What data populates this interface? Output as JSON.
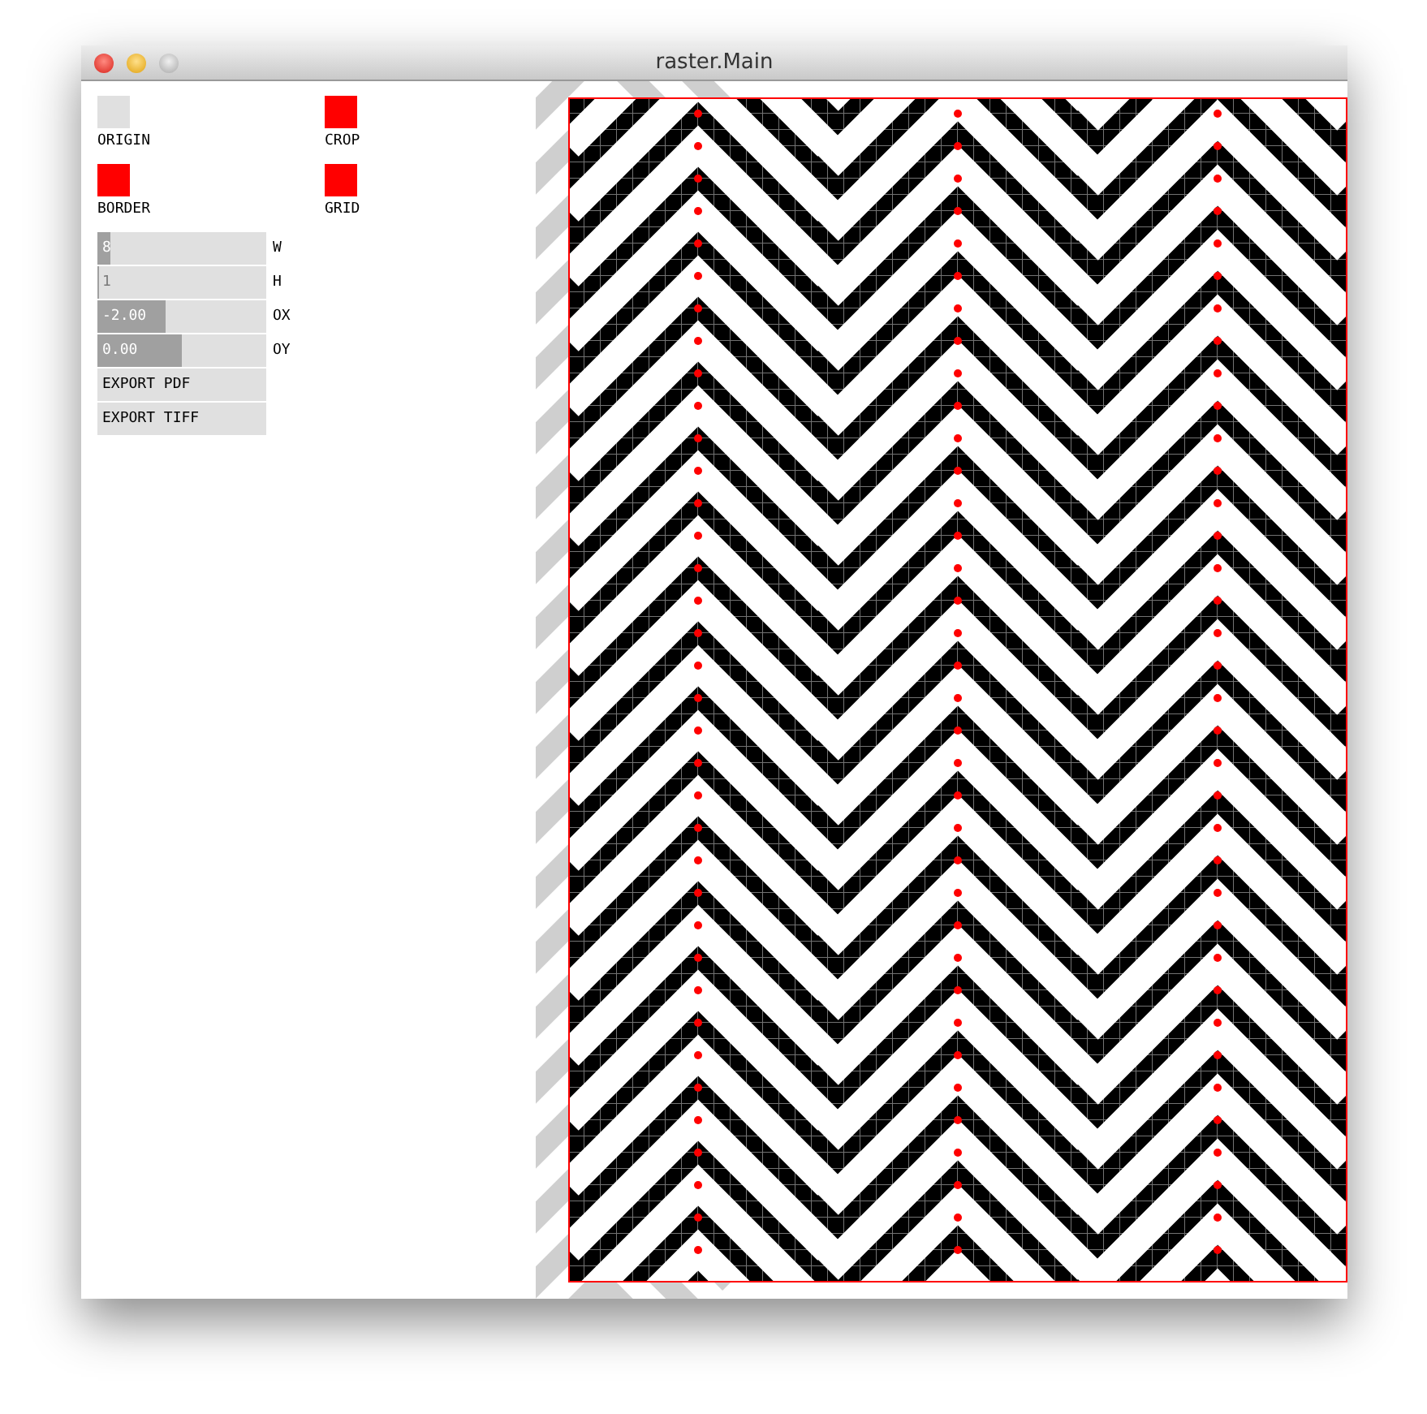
{
  "window": {
    "title": "raster.Main"
  },
  "toggles": [
    {
      "label": "ORIGIN",
      "on": false
    },
    {
      "label": "CROP",
      "on": true
    },
    {
      "label": "BORDER",
      "on": true
    },
    {
      "label": "GRID",
      "on": true
    }
  ],
  "sliders": [
    {
      "label": "W",
      "value": "8",
      "level": 0.08
    },
    {
      "label": "H",
      "value": "1",
      "level": 0.01
    },
    {
      "label": "OX",
      "value": "-2.00",
      "level": 0.4
    },
    {
      "label": "OY",
      "value": "0.00",
      "level": 0.5
    }
  ],
  "buttons": [
    "EXPORT PDF",
    "EXPORT TIFF"
  ]
}
